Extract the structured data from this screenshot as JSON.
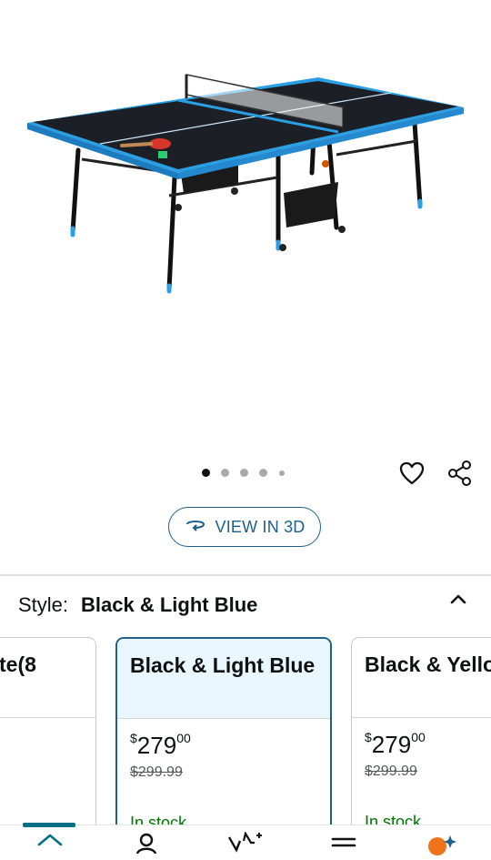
{
  "carousel": {
    "dot_count": 5,
    "active_index": 0
  },
  "actions": {
    "wishlist_icon": "heart-icon",
    "share_icon": "share-icon"
  },
  "view3d": {
    "label": "VIEW IN 3D",
    "icon": "rotate-3d-icon"
  },
  "style_selector": {
    "label": "Style:",
    "value": "Black & Light Blue",
    "toggle_icon": "chevron-up-icon"
  },
  "cards": [
    {
      "title": "te(8",
      "price_whole": "",
      "price_fraction": "",
      "list_price": "",
      "stock": ""
    },
    {
      "title": "Black & Light Blue",
      "price_whole": "279",
      "price_fraction": "00",
      "list_price": "$299.99",
      "stock": "In stock",
      "currency": "$"
    },
    {
      "title": "Black & Yello",
      "price_whole": "279",
      "price_fraction": "00",
      "list_price": "$299.99",
      "stock": "In stock",
      "currency": "$"
    }
  ],
  "bottom_nav": {
    "items": [
      {
        "icon": "home-icon",
        "active": true
      },
      {
        "icon": "account-icon",
        "active": false
      },
      {
        "icon": "ai-assistant-icon",
        "active": false
      },
      {
        "icon": "menu-icon",
        "active": false
      },
      {
        "icon": "rufus-icon",
        "active": false
      }
    ]
  },
  "colors": {
    "accent": "#1f5f8b",
    "table_blue": "#3aa0e0",
    "nav_active": "#007185",
    "stock_green": "#007600"
  }
}
